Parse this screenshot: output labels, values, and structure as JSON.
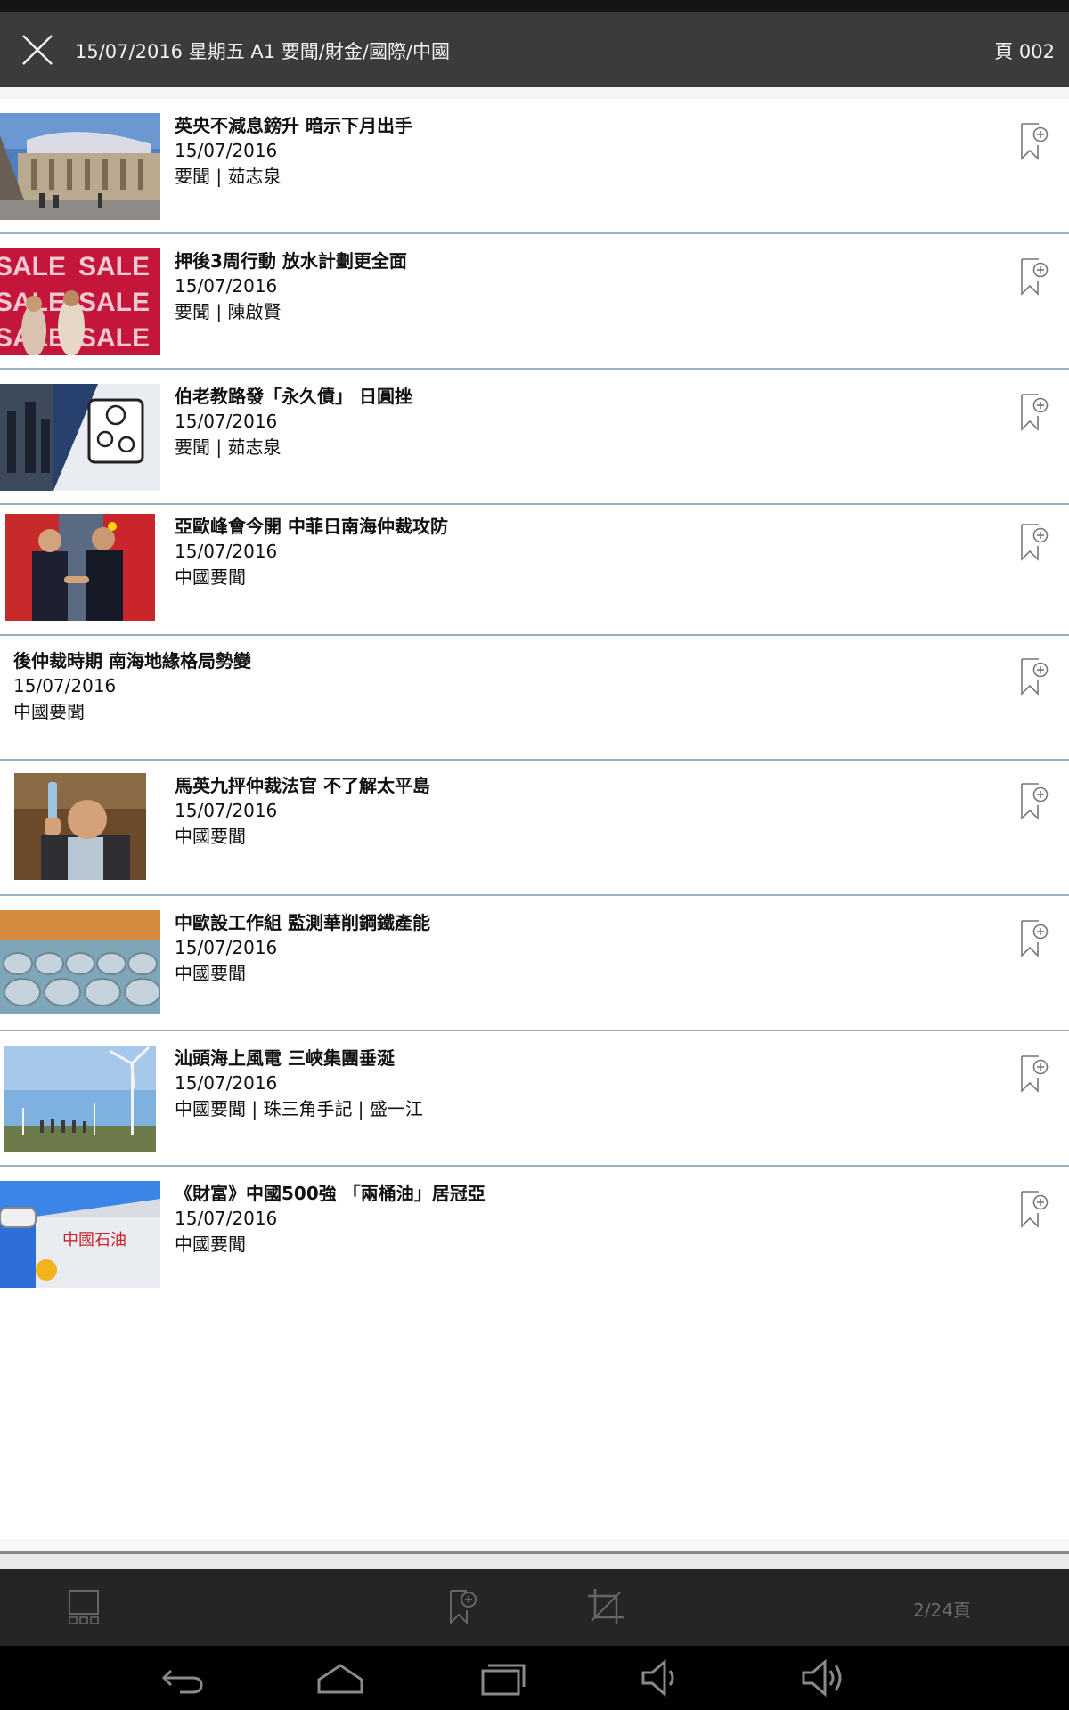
{
  "header": {
    "title": "15/07/2016 星期五   A1 要聞/財金/國際/中國",
    "page_label": "頁 002"
  },
  "articles": [
    {
      "headline": "英央不減息鎊升 暗示下月出手",
      "date": "15/07/2016",
      "meta": "要聞 | 茹志泉",
      "thumb": "bank-of-england-photo"
    },
    {
      "headline": "押後3周行動 放水計劃更全面",
      "date": "15/07/2016",
      "meta": "要聞 | 陳啟賢",
      "thumb": "sale-banner-photo"
    },
    {
      "headline": "伯老教路發「永久債」 日圓挫",
      "date": "15/07/2016",
      "meta": "要聞 | 茹志泉",
      "thumb": "currency-sign-photo"
    },
    {
      "headline": "亞歐峰會今開 中菲日南海仲裁攻防",
      "date": "15/07/2016",
      "meta": "中國要聞",
      "thumb": "leaders-handshake-photo"
    },
    {
      "headline": "後仲裁時期 南海地緣格局勢變",
      "date": "15/07/2016",
      "meta": "中國要聞",
      "thumb": null
    },
    {
      "headline": "馬英九抨仲裁法官 不了解太平島",
      "date": "15/07/2016",
      "meta": "中國要聞",
      "thumb": "ma-ying-jeou-photo"
    },
    {
      "headline": "中歐設工作組 監測華削鋼鐵產能",
      "date": "15/07/2016",
      "meta": "中國要聞",
      "thumb": "steel-coils-photo"
    },
    {
      "headline": "汕頭海上風電 三峽集團垂涎",
      "date": "15/07/2016",
      "meta": "中國要聞 | 珠三角手記 | 盛一江",
      "thumb": "wind-turbine-photo"
    },
    {
      "headline": "《財富》中國500強 「兩桶油」居冠亞",
      "date": "15/07/2016",
      "meta": "中國要聞",
      "thumb": "petrochina-photo"
    }
  ],
  "toolbar": {
    "page_counter": "2/24頁",
    "icons": [
      "thumbnail-grid-icon",
      "bookmark-add-icon",
      "crop-icon"
    ]
  },
  "navbar": {
    "icons": [
      "back-icon",
      "home-icon",
      "recent-apps-icon",
      "volume-down-icon",
      "volume-up-icon"
    ]
  }
}
